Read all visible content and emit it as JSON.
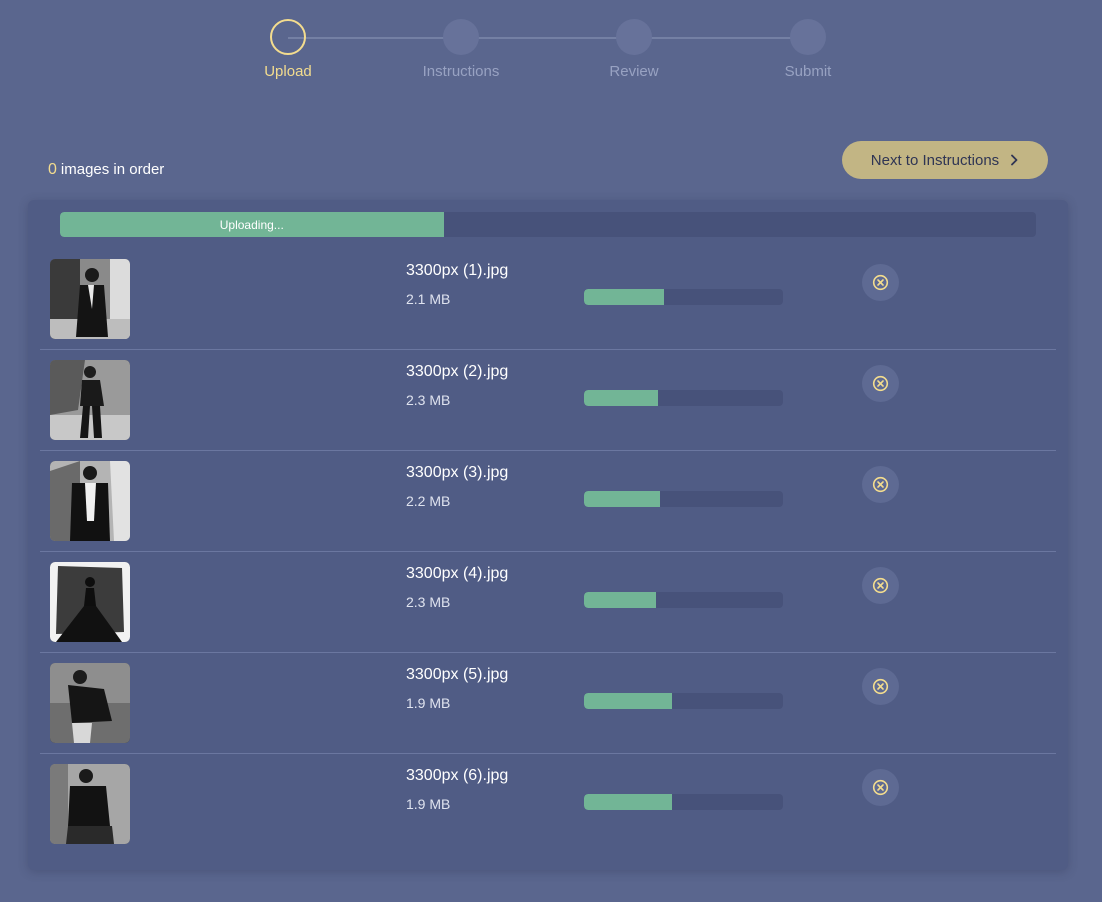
{
  "stepper": {
    "steps": [
      {
        "label": "Upload",
        "active": true
      },
      {
        "label": "Instructions",
        "active": false
      },
      {
        "label": "Review",
        "active": false
      },
      {
        "label": "Submit",
        "active": false
      }
    ]
  },
  "order": {
    "count": "0",
    "label": "images in order"
  },
  "next_button": {
    "label": "Next to Instructions",
    "icon": "chevron-right-icon"
  },
  "overall_progress": {
    "label": "Uploading...",
    "percent": 39.3
  },
  "files": [
    {
      "name": "3300px (1).jpg",
      "size": "2.1 MB",
      "progress": 40
    },
    {
      "name": "3300px (2).jpg",
      "size": "2.3 MB",
      "progress": 37
    },
    {
      "name": "3300px (3).jpg",
      "size": "2.2 MB",
      "progress": 38
    },
    {
      "name": "3300px (4).jpg",
      "size": "2.3 MB",
      "progress": 36
    },
    {
      "name": "3300px (5).jpg",
      "size": "1.9 MB",
      "progress": 44
    },
    {
      "name": "3300px (6).jpg",
      "size": "1.9 MB",
      "progress": 44
    }
  ],
  "colors": {
    "background": "#5a668e",
    "panel": "#505c85",
    "accent": "#f3dc8e",
    "button": "#c2b584",
    "progress_fill": "#72b596",
    "progress_track": "#47527a"
  }
}
